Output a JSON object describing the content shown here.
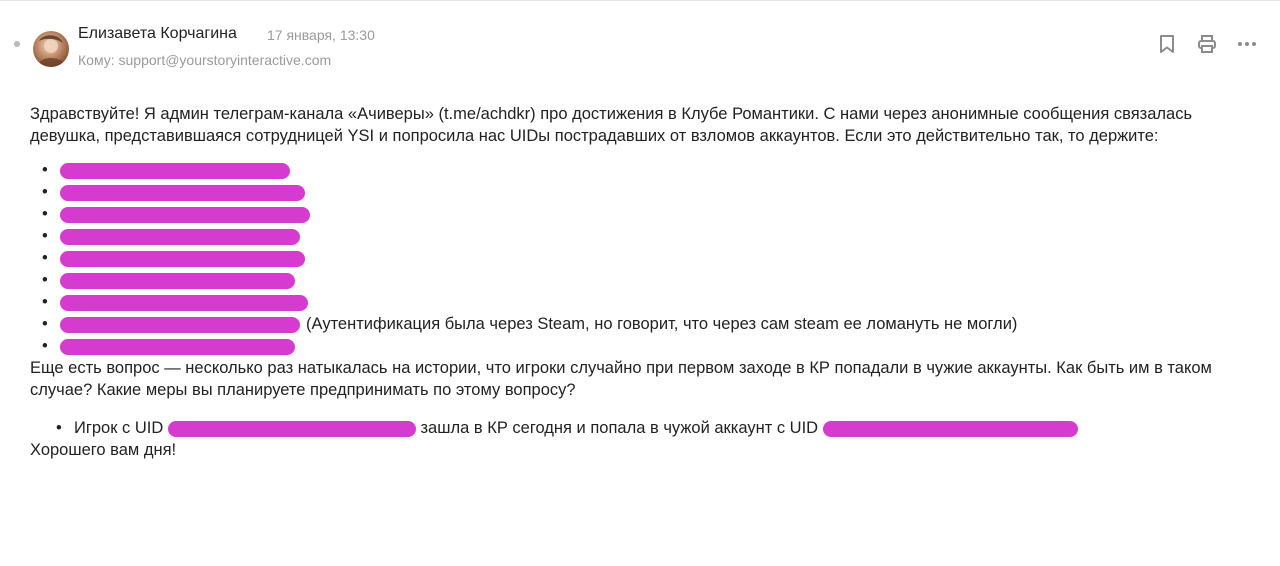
{
  "message": {
    "sender_name": "Елизавета Корчагина",
    "date": "17 января, 13:30",
    "recipient_label": "Кому:",
    "recipient_address": "support@yourstoryinteractive.com"
  },
  "toolbar": {
    "icons": [
      "bookmark-icon",
      "print-icon",
      "more-icon"
    ]
  },
  "body": {
    "greeting": "Здравствуйте! Я админ телеграм-канала «Ачиверы» (t.me/achdkr) про достижения в Клубе Романтики. С нами через анонимные сообщения связалась девушка, представившаяся сотрудницей YSI и попросила нас UIDы пострадавших от взломов аккаунтов. Если это действительно так, то держите:",
    "uid_items_count": 9,
    "uid_item_8_note": "(Аутентификация была через Steam, но говорит, что через сам steam ее ломануть не могли)",
    "question": "Еще есть вопрос — несколько раз натыкалась на истории, что игроки случайно при первом заходе в КР попадали в чужие аккаунты. Как быть им в таком случае? Какие меры вы планируете предпринимать по этому вопросу?",
    "case_prefix": "Игрок с UID",
    "case_middle": "зашла в КР сегодня и попала в чужой аккаунт с UID",
    "closing": "Хорошего вам дня!"
  },
  "colors": {
    "redaction": "#d63bd0",
    "meta_gray": "#9a9a9a",
    "text": "#222222"
  }
}
